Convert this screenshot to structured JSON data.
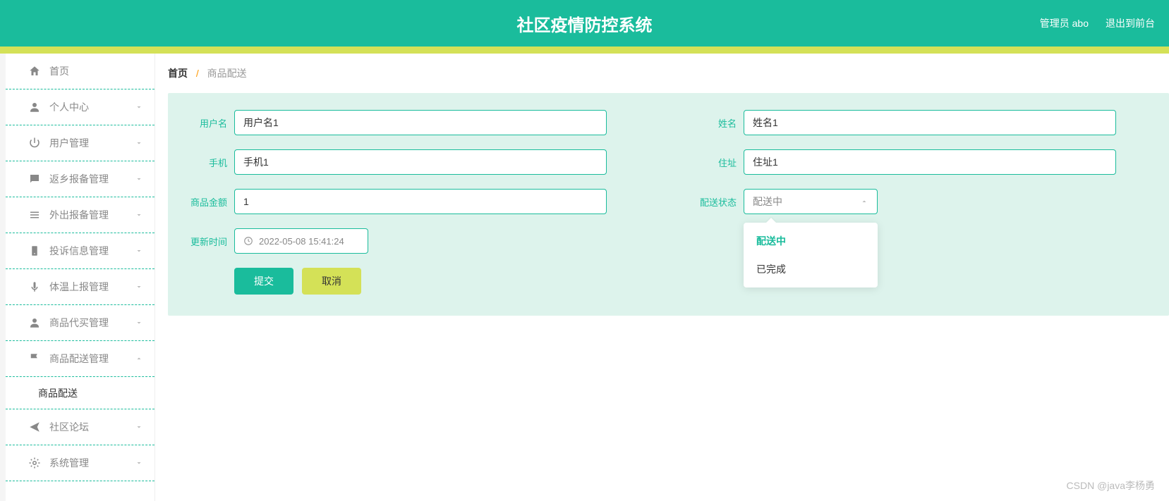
{
  "header": {
    "title": "社区疫情防控系统",
    "userLabel": "管理员 abo",
    "logout": "退出到前台"
  },
  "sidebar": {
    "items": [
      {
        "label": "首页",
        "icon": "home",
        "arrow": null
      },
      {
        "label": "个人中心",
        "icon": "user",
        "arrow": "down"
      },
      {
        "label": "用户管理",
        "icon": "power",
        "arrow": "down"
      },
      {
        "label": "返乡报备管理",
        "icon": "chat",
        "arrow": "down"
      },
      {
        "label": "外出报备管理",
        "icon": "list",
        "arrow": "down"
      },
      {
        "label": "投诉信息管理",
        "icon": "report",
        "arrow": "down"
      },
      {
        "label": "体温上报管理",
        "icon": "mic",
        "arrow": "down"
      },
      {
        "label": "商品代买管理",
        "icon": "person",
        "arrow": "down"
      },
      {
        "label": "商品配送管理",
        "icon": "flag",
        "arrow": "up",
        "sub": [
          {
            "label": "商品配送"
          }
        ]
      },
      {
        "label": "社区论坛",
        "icon": "send",
        "arrow": "down"
      },
      {
        "label": "系统管理",
        "icon": "gear",
        "arrow": "down"
      }
    ]
  },
  "breadcrumb": {
    "home": "首页",
    "current": "商品配送"
  },
  "form": {
    "username": {
      "label": "用户名",
      "value": "用户名1"
    },
    "name": {
      "label": "姓名",
      "value": "姓名1"
    },
    "phone": {
      "label": "手机",
      "value": "手机1"
    },
    "address": {
      "label": "住址",
      "value": "住址1"
    },
    "amount": {
      "label": "商品金额",
      "value": "1"
    },
    "status": {
      "label": "配送状态",
      "value": "配送中",
      "options": [
        "配送中",
        "已完成"
      ]
    },
    "updated": {
      "label": "更新时间",
      "value": "2022-05-08 15:41:24"
    },
    "submit": "提交",
    "cancel": "取消"
  },
  "watermark": "CSDN @java李杨勇"
}
